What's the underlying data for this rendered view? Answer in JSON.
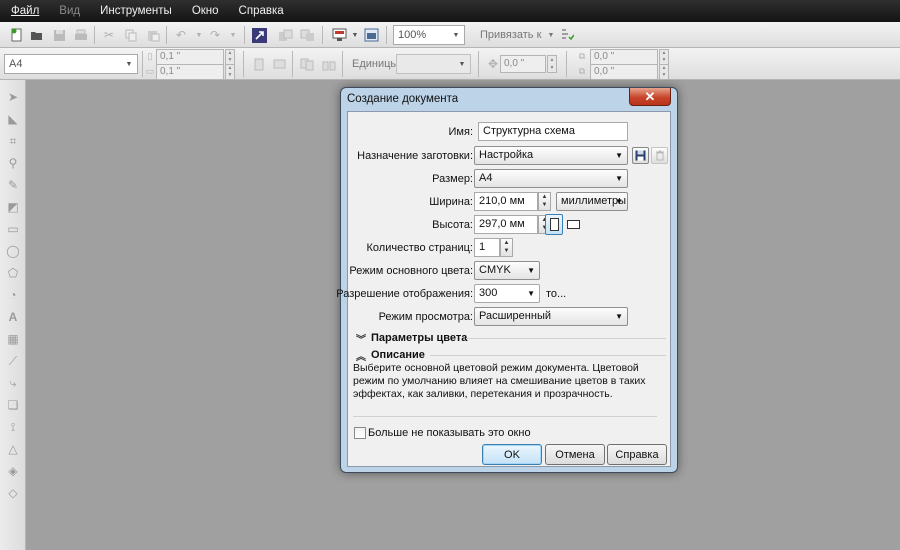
{
  "menubar": {
    "items": [
      {
        "label": "Файл",
        "enabled": true
      },
      {
        "label": "Вид",
        "enabled": false
      },
      {
        "label": "Инструменты",
        "enabled": true
      },
      {
        "label": "Окно",
        "enabled": true
      },
      {
        "label": "Справка",
        "enabled": true
      }
    ]
  },
  "toolbar1": {
    "zoom_value": "100%",
    "snap_label": "Привязать к"
  },
  "toolbar2": {
    "page_size": "A4",
    "nudge_x": "0,1 \"",
    "nudge_y": "0,1 \"",
    "units_label": "Единицы:",
    "units_value": "",
    "offset_value": "0,0 \"",
    "dup_x": "0,0 \"",
    "dup_y": "0,0 \""
  },
  "dialog": {
    "title": "Создание документа",
    "close_symbol": "✕",
    "name_label": "Имя:",
    "name_value": "Структурна схема",
    "preset_label": "Назначение заготовки:",
    "preset_value": "Настройка",
    "size_label": "Размер:",
    "size_value": "A4",
    "width_label": "Ширина:",
    "width_value": "210,0 мм",
    "units_value": "миллиметры",
    "height_label": "Высота:",
    "height_value": "297,0 мм",
    "pages_label": "Количество страниц:",
    "pages_value": "1",
    "color_mode_label": "Режим основного цвета:",
    "color_mode_value": "CMYK",
    "resolution_label": "Разрешение отображения:",
    "resolution_value": "300",
    "resolution_suffix": "то...",
    "preview_label": "Режим просмотра:",
    "preview_value": "Расширенный",
    "color_params_heading": "Параметры цвета",
    "description_heading": "Описание",
    "description_text": "Выберите основной цветовой режим документа. Цветовой режим по умолчанию влияет на смешивание цветов в таких эффектах, как заливки, перетекания и прозрачность.",
    "dont_show_label": "Больше не показывать это окно",
    "dont_show_checked": false,
    "ok_label": "OK",
    "cancel_label": "Отмена",
    "help_label": "Справка"
  },
  "colors": {
    "menubar_bg": "#1e1e1e",
    "workspace_bg": "#a0a0a0",
    "dialog_frame": "#bcd3e8",
    "close_button": "#c7452b"
  }
}
